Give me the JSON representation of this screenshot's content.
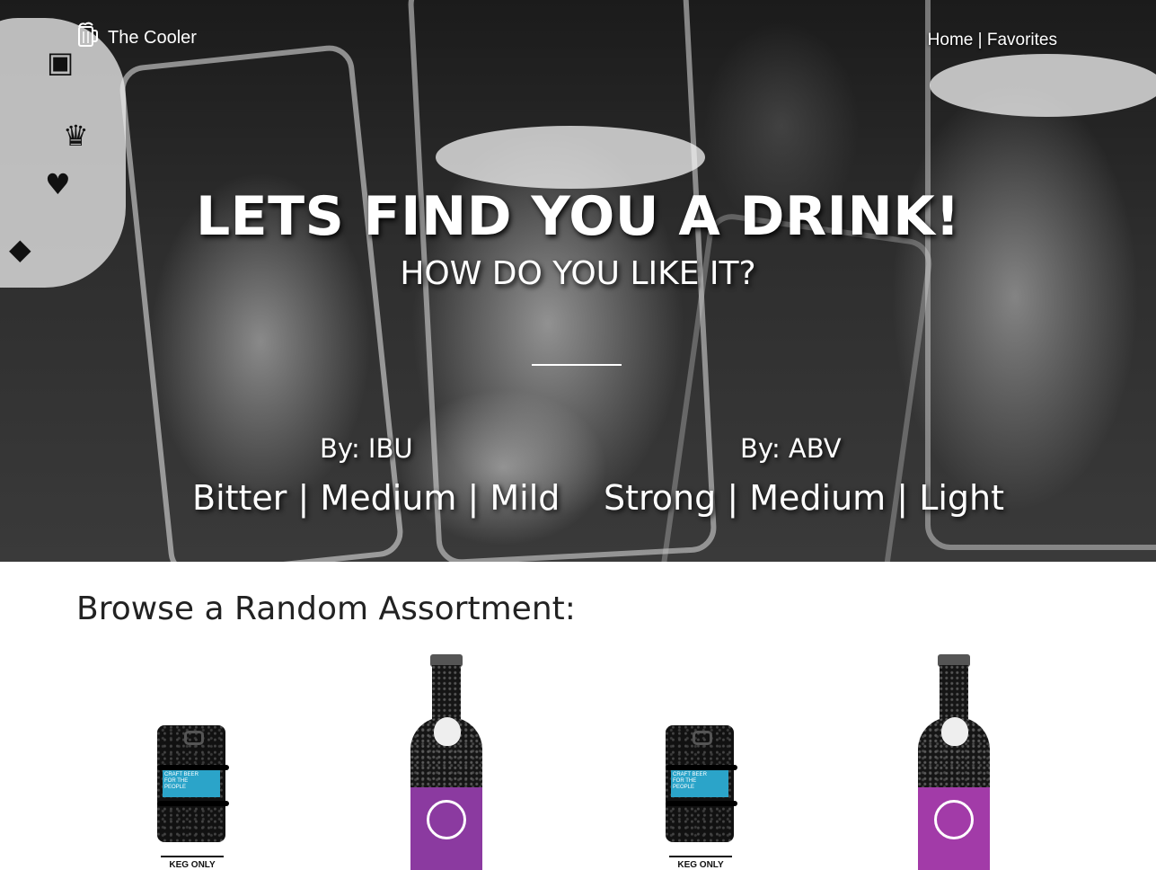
{
  "header": {
    "brand": "The Cooler",
    "brand_icon": "beer-mug-icon",
    "nav": {
      "home": "Home",
      "separator": "|",
      "favorites": "Favorites"
    }
  },
  "hero": {
    "title": "LETS FIND YOU A DRINK!",
    "subtitle": "HOW DO YOU LIKE IT?",
    "ibu": {
      "label": "By: IBU",
      "options": [
        "Bitter",
        "Medium",
        "Mild"
      ]
    },
    "abv": {
      "label": "By: ABV",
      "options": [
        "Strong",
        "Medium",
        "Light"
      ]
    },
    "option_separator": "|"
  },
  "browse": {
    "title": "Browse a Random Assortment:",
    "products": [
      {
        "type": "keg",
        "label_lines": [
          "CRAFT BEER",
          "FOR THE",
          "PEOPLE"
        ],
        "caption": "KEG ONLY",
        "accent": "#2ba4c9"
      },
      {
        "type": "bottle",
        "label_color": "#8b3aa0"
      },
      {
        "type": "keg",
        "label_lines": [
          "CRAFT BEER",
          "FOR THE",
          "PEOPLE"
        ],
        "caption": "KEG ONLY",
        "accent": "#2ba4c9"
      },
      {
        "type": "bottle",
        "label_color": "#a23ba8"
      }
    ]
  }
}
